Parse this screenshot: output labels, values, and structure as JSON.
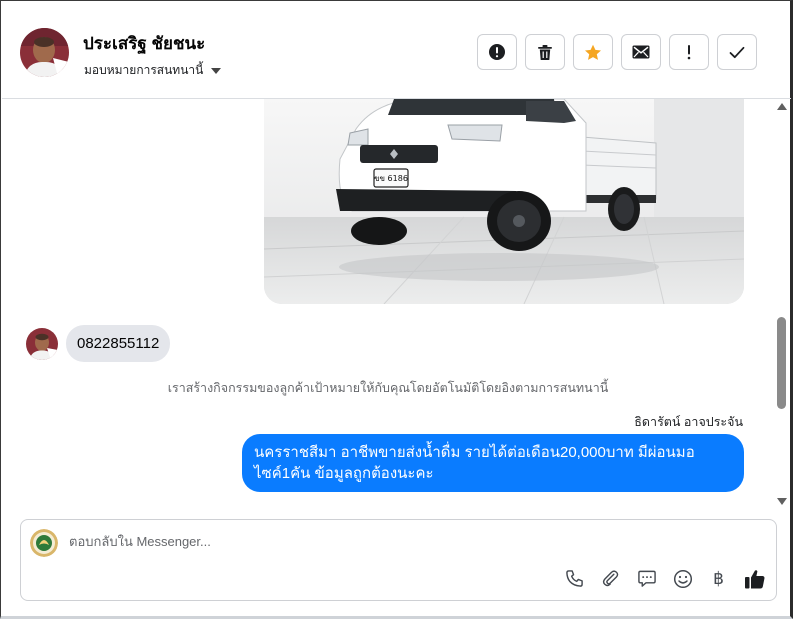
{
  "header": {
    "contact_name": "ประเสริฐ ชัยชนะ",
    "assign_label": "มอบหมายการสนทนานี้",
    "actions": [
      {
        "name": "spam-button",
        "icon": "alert-circle-icon"
      },
      {
        "name": "delete-button",
        "icon": "trash-icon"
      },
      {
        "name": "star-button",
        "icon": "star-icon"
      },
      {
        "name": "mark-unread-button",
        "icon": "envelope-icon"
      },
      {
        "name": "follow-up-button",
        "icon": "exclamation-icon"
      },
      {
        "name": "mark-done-button",
        "icon": "checkmark-icon"
      }
    ]
  },
  "messages": {
    "incoming_text": "0822855112",
    "system_note": "เราสร้างกิจกรรมของลูกค้าเป้าหมายให้กับคุณโดยอัตโนมัติโดยอิงตามการสนทนานี้",
    "sender_name": "ธิดารัตน์ อาจประจัน",
    "outgoing_line1": "นครราชสีมา อาชีพขายส่งน้ำดื่ม รายได้ต่อเดือน20,000บาท มีผ่อนมอ",
    "outgoing_line2": "ไซค์1คัน ข้อมูลถูกต้องนะคะ",
    "car_plate": "ขข 6186"
  },
  "composer": {
    "placeholder": "ตอบกลับใน Messenger...",
    "baht_symbol": "฿",
    "tools": [
      "phone-icon",
      "paperclip-icon",
      "chat-bubble-icon",
      "emoji-icon",
      "baht-icon",
      "thumbs-up-icon"
    ]
  },
  "colors": {
    "accent_blue": "#0a7cff",
    "star_orange": "#f5a623",
    "incoming_bubble": "#e4e6eb",
    "like_icon": "#1c1e21"
  }
}
